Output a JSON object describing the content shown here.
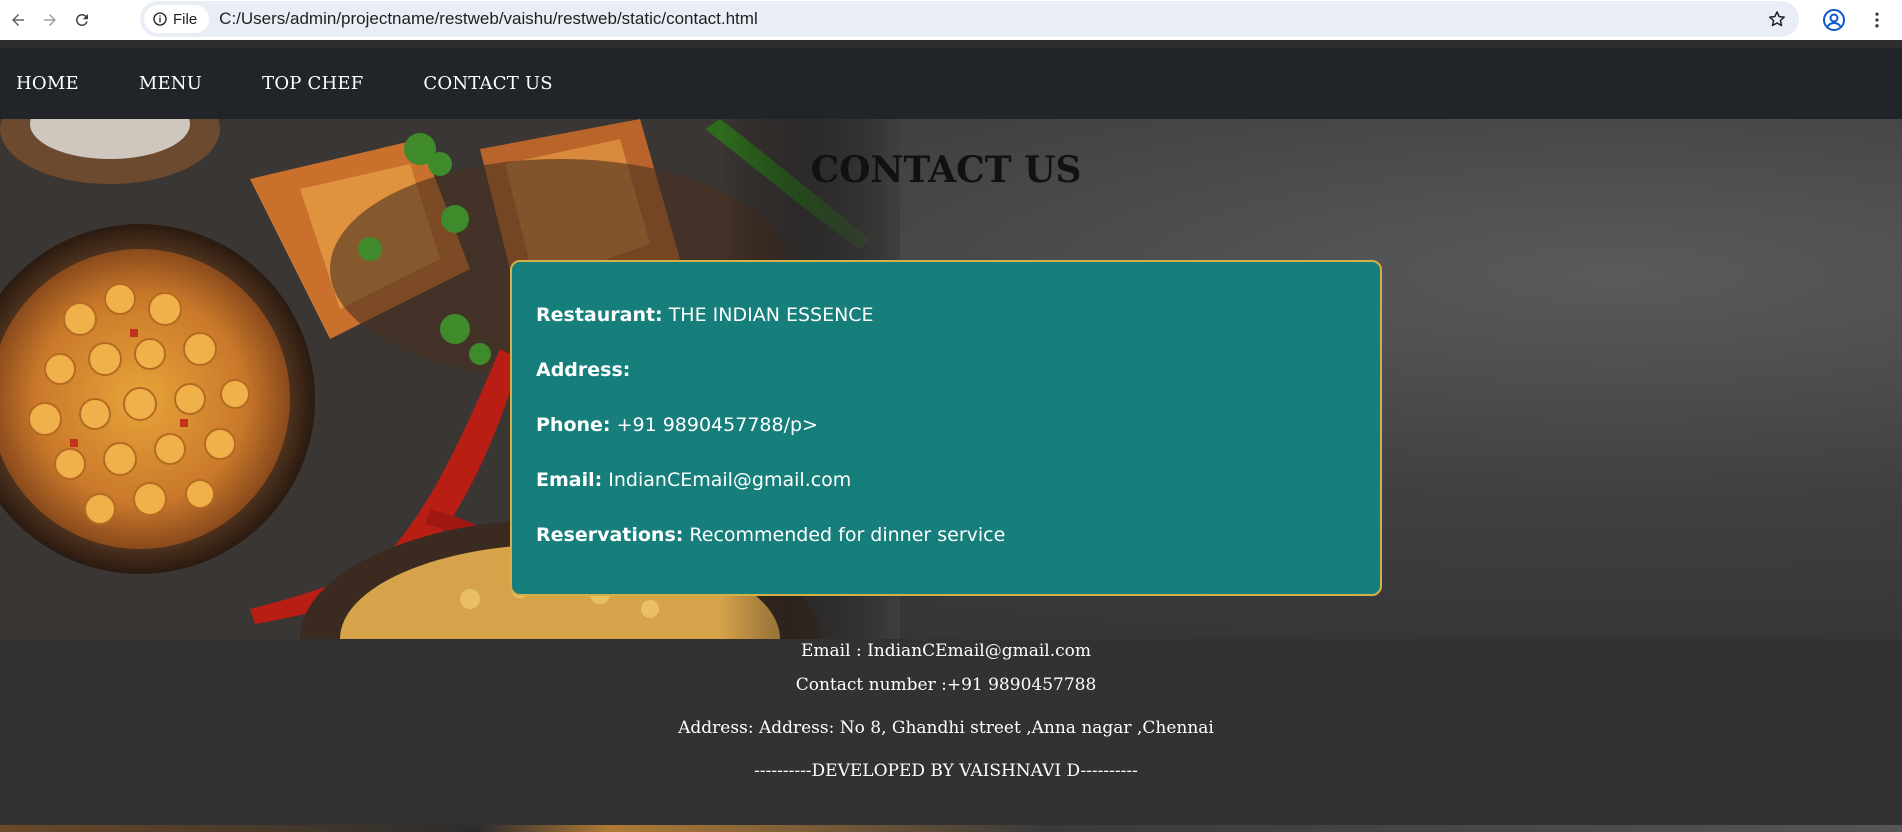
{
  "browser": {
    "file_chip": "File",
    "url": "C:/Users/admin/projectname/restweb/vaishu/restweb/static/contact.html"
  },
  "nav": {
    "items": [
      "HOME",
      "MENU",
      "TOP CHEF",
      "CONTACT US"
    ]
  },
  "page": {
    "title": "CONTACT US"
  },
  "card": {
    "restaurant_label": "Restaurant:",
    "restaurant_value": "THE INDIAN ESSENCE",
    "address_label": "Address:",
    "address_value": "",
    "phone_label": "Phone:",
    "phone_value": "+91 9890457788/p>",
    "email_label": "Email:",
    "email_value": "IndianCEmail@gmail.com",
    "reservations_label": "Reservations:",
    "reservations_value": "Recommended for dinner service"
  },
  "footer": {
    "email": "Email : IndianCEmail@gmail.com",
    "contact": "Contact number :+91 9890457788",
    "address": "Address: Address: No 8, Ghandhi street ,Anna nagar ,Chennai",
    "developer": "----------DEVELOPED BY VAISHNAVI D----------"
  },
  "colors": {
    "nav_bg": "#212529",
    "card_bg": "#167e7b",
    "card_border": "#d4b04a",
    "footer_bg": "#323232"
  },
  "icons": [
    "back-arrow-icon",
    "forward-arrow-icon",
    "reload-icon",
    "info-icon",
    "star-icon",
    "profile-icon",
    "kebab-menu-icon"
  ]
}
